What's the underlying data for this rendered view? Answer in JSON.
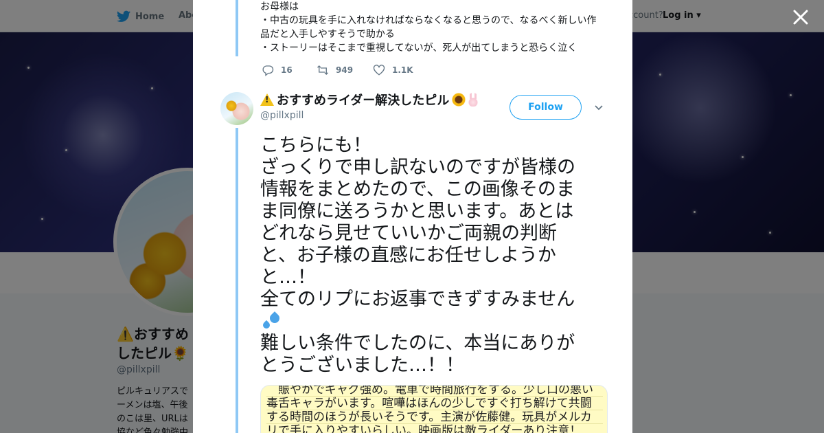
{
  "nav": {
    "home_label": "Home",
    "about_label": "Abo",
    "account_text": "ccount?",
    "login_label": "Log in"
  },
  "profile": {
    "name": "⚠️おすすめ\nしたピル🌻",
    "handle": "@pillxpill",
    "bio": "ピルキュリアスで\nーメンは塩、午後\nのこは里、URLは\n協など色々勉強中"
  },
  "previous_tweet": {
    "lines": [
      "お母様は",
      "・中古の玩具を手に入れなければならなくなると思うので、なるべく新しい作",
      "品だと入手しやすそうで助かる",
      "・ストーリーはそこまで重視してないが、死人が出てしまうと恐らく泣く"
    ],
    "reply_count": "16",
    "retweet_count": "949",
    "like_count": "1.1K"
  },
  "tweet": {
    "display_name": "おすすめライダー解決したピル",
    "handle": "@pillxpill",
    "follow_label": "Follow",
    "lines": [
      "こちらにも！",
      "ざっくりで申し訳ないのですが皆様の",
      "情報をまとめたので、この画像そのま",
      "ま同僚に送ろうかと思います。あとは",
      "どれなら見せていいかご両親の判断",
      "と、お子様の直感にお任せしようか",
      "と…！",
      "全てのリプにお返事できずすみません",
      "",
      "難しい条件でしたのに、本当にありが",
      "とうございました…！！"
    ],
    "media_lines": [
      "　賑やかでギャグ強め。電車で時間旅行をする。少し口の悪い",
      "毒舌キャラがいます。喧嘩はほんの少しですぐ打ち解けて共闘",
      "する時間のほうが長いそうです。主演が佐藤健。玩具がメルカ",
      "リで手に入りやすいらしい。映画版は敵ライダーあり注意！"
    ]
  },
  "colors": {
    "twitter_blue": "#1da1f2",
    "thread_line": "#8ec8f5",
    "media_background": "#fffbc4"
  },
  "icons": {
    "twitter": "twitter-bird-icon",
    "reply": "reply-icon",
    "retweet": "retweet-icon",
    "like": "heart-icon",
    "close": "close-icon",
    "caret": "chevron-down-icon"
  }
}
